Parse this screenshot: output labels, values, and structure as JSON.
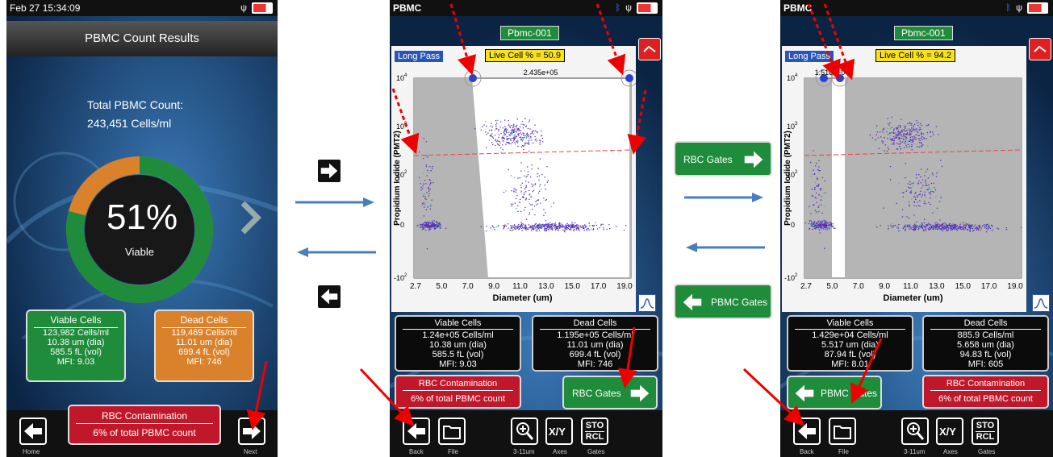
{
  "screen1": {
    "datetime": "Feb 27 15:34:09",
    "title": "PBMC Count Results",
    "total_label": "Total PBMC Count:",
    "total_value": "243,451 Cells/ml",
    "percent": "51%",
    "viable_label": "Viable",
    "viable_fraction": 0.51,
    "viable_tile": {
      "title": "Viable Cells",
      "lines": [
        "123,982 Cells/ml",
        "10.38 um (dia)",
        "585.5 fL (vol)",
        "MFI:  9.03"
      ]
    },
    "dead_tile": {
      "title": "Dead Cells",
      "lines": [
        "119,469 Cells/ml",
        "11.01 um (dia)",
        "699.4 fL (vol)",
        "MFI:  746"
      ]
    },
    "rbc": {
      "title": "RBC Contamination",
      "value": "6% of total PBMC count"
    },
    "home_label": "Home",
    "next_label": "Next"
  },
  "screen2": {
    "app": "PBMC",
    "sample": "Pbmc-001",
    "mode": "Long Pass",
    "live_cell": "Live Cell % = 50.9",
    "gate_value": "2.435e+05",
    "viable_tile": {
      "title": "Viable Cells",
      "lines": [
        "1.24e+05 Cells/ml",
        "10.38 um (dia)",
        "585.5 fL (vol)",
        "MFI:  9.03"
      ]
    },
    "dead_tile": {
      "title": "Dead Cells",
      "lines": [
        "1.195e+05 Cells/ml",
        "11.01 um (dia)",
        "699.4 fL (vol)",
        "MFI:  746"
      ]
    },
    "rbc": {
      "title": "RBC Contamination",
      "value": "6% of total PBMC count"
    },
    "gates_button": "RBC Gates",
    "toolbar": {
      "back": "Back",
      "file": "File",
      "zoom": "3-11um",
      "axes": "Axes",
      "gates": "Gates",
      "xy": "X/Y",
      "sto": "STO",
      "rcl": "RCL"
    }
  },
  "screen3": {
    "app": "PBMC",
    "sample": "Pbmc-001",
    "mode": "Long Pass",
    "live_cell": "Live Cell % = 94.2",
    "gate_value": "1.518e+04",
    "viable_tile": {
      "title": "Viable Cells",
      "lines": [
        "1.429e+04 Cells/ml",
        "5.517 um (dia)",
        "87.94 fL (vol)",
        "MFI:  8.01"
      ]
    },
    "dead_tile": {
      "title": "Dead Cells",
      "lines": [
        "885.9 Cells/ml",
        "5.658 um (dia)",
        "94.83 fL (vol)",
        "MFI:  605"
      ]
    },
    "rbc": {
      "title": "RBC Contamination",
      "value": "6% of total PBMC count"
    },
    "gates_button": "PBMC Gates",
    "toolbar": {
      "back": "Back",
      "file": "File",
      "zoom": "3-11um",
      "axes": "Axes",
      "gates": "Gates",
      "xy": "X/Y",
      "sto": "STO",
      "rcl": "RCL"
    }
  },
  "middle": {
    "rbc_gates": "RBC Gates",
    "pbmc_gates": "PBMC Gates"
  },
  "plot": {
    "xlabel": "Diameter (um)",
    "ylabel": "Propidium Iodide (PMT2)",
    "xticks": [
      "2.7",
      "5.0",
      "7.0",
      "9.0",
      "11.0",
      "13.0",
      "15.0",
      "17.0",
      "19.0"
    ],
    "yticks": [
      "10",
      "10",
      "10",
      "0",
      "-10"
    ],
    "yexp": [
      "4",
      "3",
      "2",
      "",
      "2"
    ]
  },
  "colors": {
    "green": "#1e8c3a",
    "orange": "#d9822b",
    "red": "#c0182a",
    "blue": "#2a55b8",
    "yellow": "#f7e21b"
  }
}
